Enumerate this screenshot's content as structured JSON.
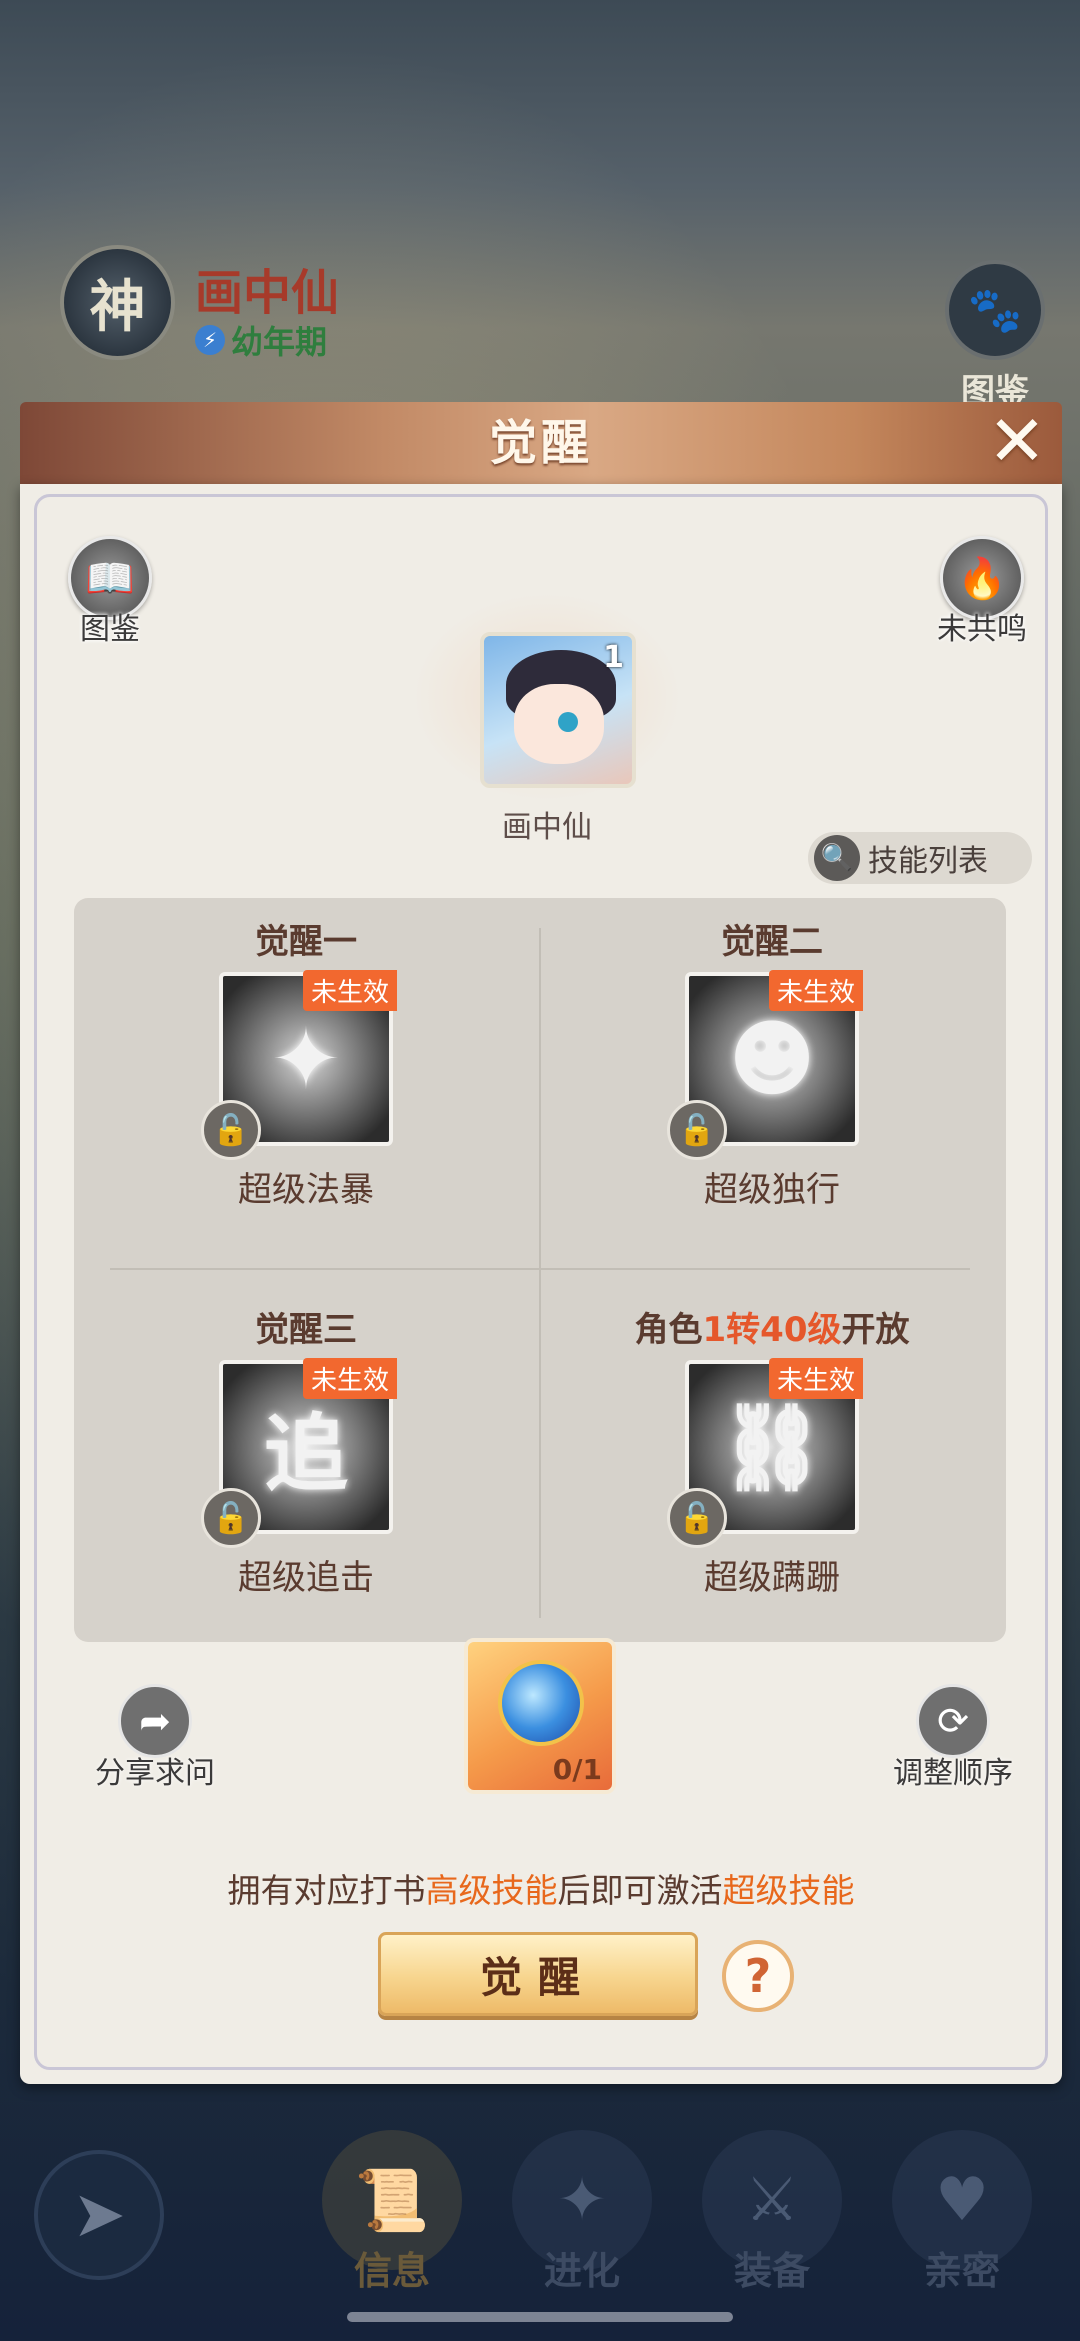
{
  "background": {
    "pet_badge": "神",
    "pet_name": "画中仙",
    "pet_stage": "幼年期",
    "atlas_label": "图鉴"
  },
  "dialog": {
    "title": "觉醒",
    "left_button": "图鉴",
    "right_button": "未共鸣",
    "avatar_level": "1",
    "avatar_name": "画中仙",
    "skill_list_label": "技能列表",
    "cells": [
      {
        "title": "觉醒一",
        "tag": "未生效",
        "skill": "超级法暴",
        "glyph": "✦"
      },
      {
        "title": "觉醒二",
        "tag": "未生效",
        "skill": "超级独行",
        "glyph": "☻"
      },
      {
        "title": "觉醒三",
        "tag": "未生效",
        "skill": "超级追击",
        "glyph": "追"
      },
      {
        "title_pre": "角色",
        "title_hl": "1转40级",
        "title_post": "开放",
        "tag": "未生效",
        "skill": "超级蹒跚",
        "glyph": "⛓"
      }
    ],
    "share_label": "分享求问",
    "order_label": "调整顺序",
    "item_count": "0/1",
    "tip": {
      "part1": "拥有对应打书",
      "hl1": "高级技能",
      "part2": "后即可激活",
      "hl2": "超级技能"
    },
    "awaken_button": "觉醒",
    "help_button": "?"
  },
  "bottom_nav": {
    "tabs": [
      {
        "label": "信息",
        "icon": "scroll-icon"
      },
      {
        "label": "进化",
        "icon": "sparkle-icon"
      },
      {
        "label": "装备",
        "icon": "armor-icon"
      },
      {
        "label": "亲密",
        "icon": "hearts-icon"
      }
    ],
    "active_tab": "信息"
  },
  "colors": {
    "accent_orange": "#e8681c",
    "tag_orange": "#f2682f",
    "title_brown": "#5a3b2f"
  }
}
